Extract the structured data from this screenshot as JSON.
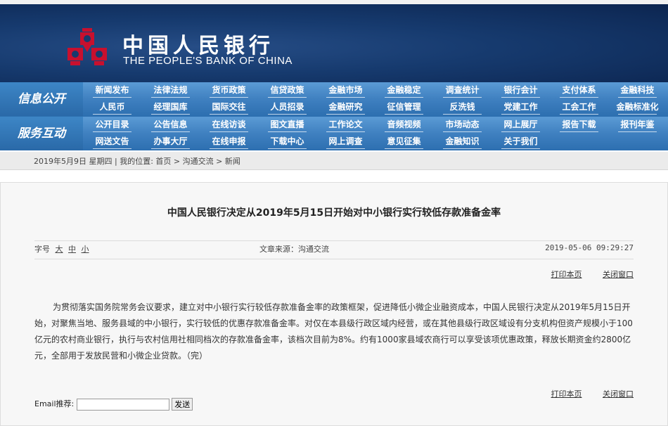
{
  "header": {
    "logo_cn": "中国人民银行",
    "logo_en": "THE PEOPLE'S BANK OF CHINA",
    "brand_color": "#c8102e",
    "bg_color": "#163a6e"
  },
  "nav": {
    "groups": [
      {
        "title": "信息公开",
        "rows": [
          [
            "新闻发布",
            "法律法规",
            "货币政策",
            "信贷政策",
            "金融市场",
            "金融稳定",
            "调查统计",
            "银行会计",
            "支付体系",
            "金融科技"
          ],
          [
            "人民币",
            "经理国库",
            "国际交往",
            "人员招录",
            "金融研究",
            "征信管理",
            "反洗钱",
            "党建工作",
            "工会工作",
            "金融标准化"
          ]
        ]
      },
      {
        "title": "服务互动",
        "rows": [
          [
            "公开目录",
            "公告信息",
            "在线访谈",
            "图文直播",
            "工作论文",
            "音频视频",
            "市场动态",
            "网上展厅",
            "报告下载",
            "报刊年鉴"
          ],
          [
            "网送文告",
            "办事大厅",
            "在线申报",
            "下载中心",
            "网上调查",
            "意见征集",
            "金融知识",
            "关于我们"
          ]
        ]
      }
    ]
  },
  "breadcrumb": {
    "date": "2019年5月9日  星期四",
    "location_prefix": "我的位置:",
    "items": [
      "首页",
      "沟通交流",
      "新闻"
    ]
  },
  "article": {
    "title": "中国人民银行决定从2019年5月15日开始对中小银行实行较低存款准备金率",
    "font_label": "字号",
    "font_sizes": [
      "大",
      "中",
      "小"
    ],
    "source": "文章来源：沟通交流",
    "date": "2019-05-06  09:29:27",
    "print_label": "打印本页",
    "close_label": "关闭窗口",
    "body": "为贯彻落实国务院常务会议要求，建立对中小银行实行较低存款准备金率的政策框架，促进降低小微企业融资成本，中国人民银行决定从2019年5月15日开始，对聚焦当地、服务县域的中小银行，实行较低的优惠存款准备金率。对仅在本县级行政区域内经营，或在其他县级行政区域设有分支机构但资产规模小于100亿元的农村商业银行，执行与农村信用社相同档次的存款准备金率，该档次目前为8%。约有1000家县域农商行可以享受该项优惠政策，释放长期资金约2800亿元，全部用于发放民营和小微企业贷款。（完）"
  },
  "email": {
    "label": "Email推荐:",
    "value": "",
    "send_label": "发送"
  }
}
